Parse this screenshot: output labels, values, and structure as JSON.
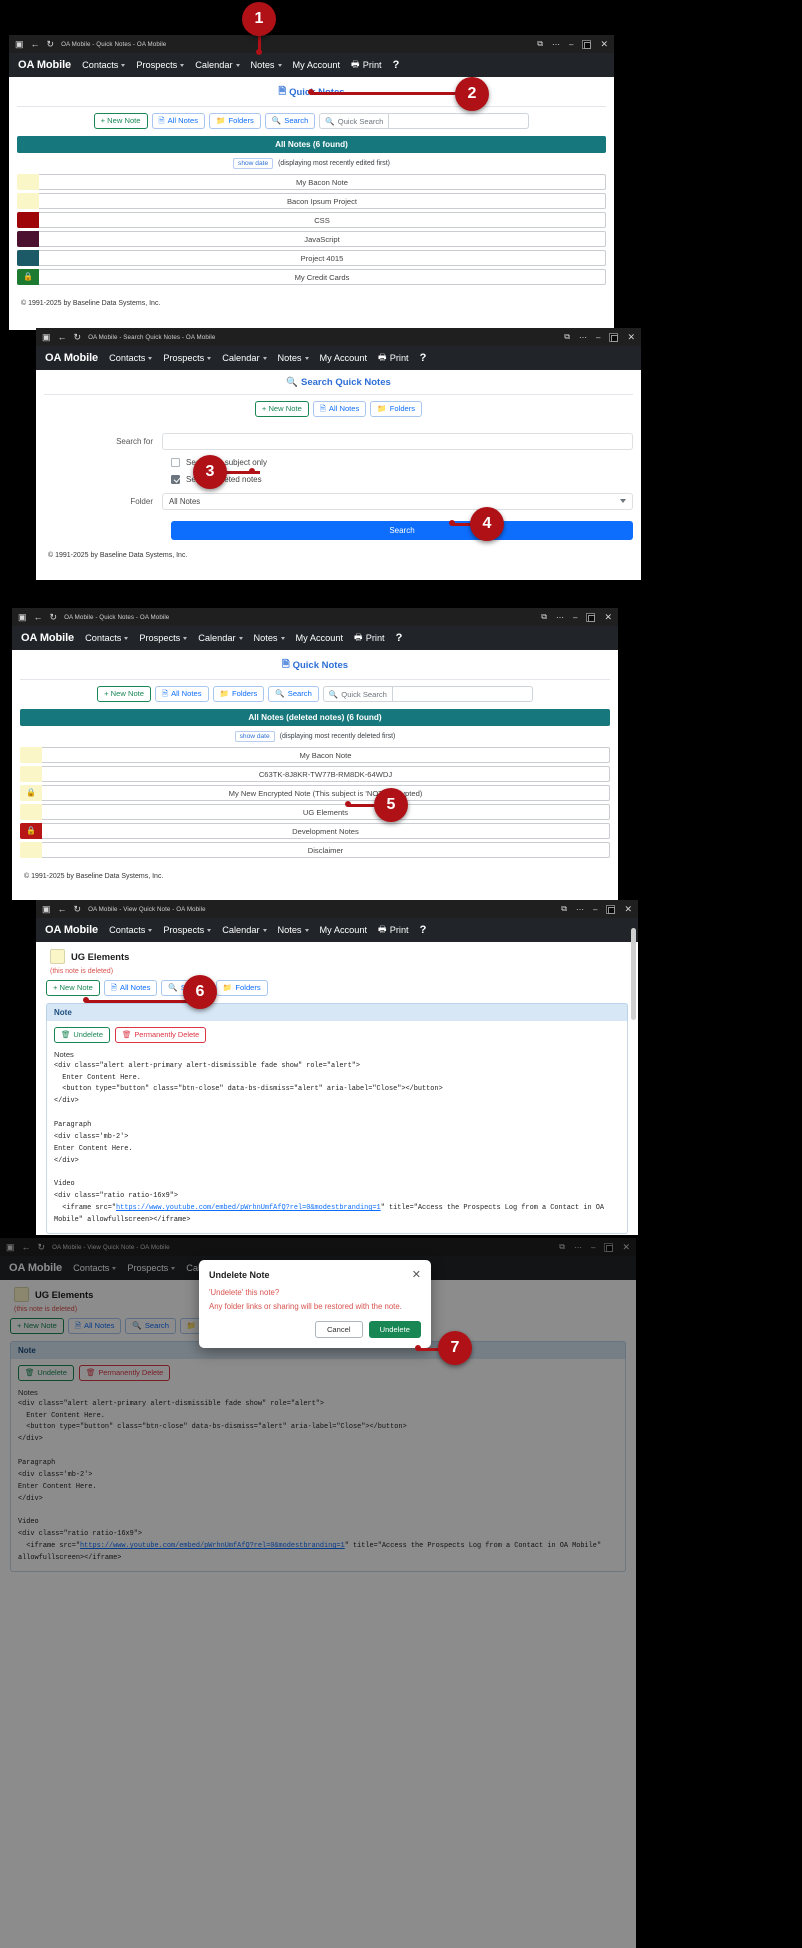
{
  "app": {
    "brand": "OA Mobile",
    "nav": [
      {
        "label": "Contacts",
        "caret": true
      },
      {
        "label": "Prospects",
        "caret": true
      },
      {
        "label": "Calendar",
        "caret": true
      },
      {
        "label": "Notes",
        "caret": true
      },
      {
        "label": "My Account",
        "caret": false
      },
      {
        "label": "Print",
        "caret": false,
        "icon": "printer-icon"
      },
      {
        "label": "?",
        "caret": false
      }
    ],
    "footer": "© 1991-2025 by Baseline Data Systems, Inc."
  },
  "panel1": {
    "window_title": "OA Mobile - Quick Notes - OA Mobile",
    "page_title": "Quick Notes",
    "toolbar": {
      "new_note": "+ New Note",
      "all_notes": "All Notes",
      "folders": "Folders",
      "search": "Search",
      "quick_search_label": "Quick Search",
      "quick_search_value": ""
    },
    "results_bar": "All Notes (6 found)",
    "show_date": "show date",
    "sort_note": "(displaying most recently edited first)",
    "notes": [
      {
        "subject": "My Bacon Note",
        "color": "#fbf6c8",
        "locked": false
      },
      {
        "subject": "Bacon Ipsum Project",
        "color": "#fbf6c8",
        "locked": false
      },
      {
        "subject": "CSS",
        "color": "#9e0509",
        "locked": false
      },
      {
        "subject": "JavaScript",
        "color": "#4b112f",
        "locked": false
      },
      {
        "subject": "Project 4015",
        "color": "#1b5a66",
        "locked": false
      },
      {
        "subject": "My Credit Cards",
        "color": "#1d7a31",
        "locked": true
      }
    ]
  },
  "panel2": {
    "window_title": "OA Mobile - Search Quick Notes - OA Mobile",
    "page_title": "Search Quick Notes",
    "toolbar": {
      "new_note": "+ New Note",
      "all_notes": "All Notes",
      "folders": "Folders"
    },
    "form": {
      "search_for_label": "Search for",
      "search_for_value": "",
      "subject_only_label": "Search on subject only",
      "subject_only_checked": false,
      "deleted_label": "Search deleted notes",
      "deleted_checked": true,
      "folder_label": "Folder",
      "folder_value": "All Notes",
      "folder_options": [
        "All Notes"
      ],
      "search_button": "Search"
    }
  },
  "panel3": {
    "window_title": "OA Mobile - Quick Notes - OA Mobile",
    "page_title": "Quick Notes",
    "toolbar": {
      "new_note": "+ New Note",
      "all_notes": "All Notes",
      "folders": "Folders",
      "search": "Search",
      "quick_search_label": "Quick Search",
      "quick_search_value": ""
    },
    "results_bar": "All Notes (deleted notes) (6 found)",
    "show_date": "show date",
    "sort_note": "(displaying most recently deleted first)",
    "notes": [
      {
        "subject": "My Bacon Note",
        "color": "#fbf6c8",
        "locked": false
      },
      {
        "subject": "C63TK-8J8KR-TW77B-RM8DK-64WDJ",
        "color": "#fbf6c8",
        "locked": false
      },
      {
        "subject": "My New Encrypted Note (This subject is 'NOT' encrypted)",
        "color": "#fbf6c8",
        "locked": true,
        "lock_color": "#8a7f2a"
      },
      {
        "subject": "UG Elements",
        "color": "#fbf6c8",
        "locked": false
      },
      {
        "subject": "Development Notes",
        "color": "#b81616",
        "locked": true,
        "lock_color": "#ffffff"
      },
      {
        "subject": "Disclaimer",
        "color": "#fbf6c8",
        "locked": false
      }
    ]
  },
  "panel4": {
    "window_title": "OA Mobile - View Quick Note - OA Mobile",
    "note_subject": "UG Elements",
    "deleted_flag": "(this note is deleted)",
    "toolbar": {
      "new_note": "+ New Note",
      "all_notes": "All Notes",
      "search": "Search",
      "folders": "Folders"
    },
    "card_title": "Note",
    "undelete_button": "Undelete",
    "permanently_delete_button": "Permanently Delete",
    "notes_label": "Notes",
    "code_line1": "<div class=\"alert alert-primary alert-dismissible fade show\" role=\"alert\">",
    "code_line2": "  Enter Content Here.",
    "code_line3": "  <button type=\"button\" class=\"btn-close\" data-bs-dismiss=\"alert\" aria-label=\"Close\"></button>",
    "code_line4": "</div>",
    "code_h_paragraph": "Paragraph",
    "code_line5": "<div class='mb-2'>",
    "code_line6": "Enter Content Here.",
    "code_line7": "</div>",
    "code_h_video": "Video",
    "code_line8": "<div class=\"ratio ratio-16x9\">",
    "code_line9a": "  <iframe src=\"",
    "code_link": "https://www.youtube.com/embed/pWrhnUmfAfQ?rel=0&modestbranding=1",
    "code_line9b": "\" title=\"Access the Prospects Log from a Contact in OA Mobile\" allowfullscreen></iframe>"
  },
  "panel5": {
    "window_title": "OA Mobile - View Quick Note - OA Mobile",
    "note_subject": "UG Elements",
    "deleted_flag": "(this note is deleted)",
    "toolbar": {
      "new_note": "+ New Note",
      "all_notes": "All Notes",
      "search": "Search",
      "folders": "Folders"
    },
    "card_title": "Note",
    "undelete_button": "Undelete",
    "permanently_delete_button": "Permanently Delete",
    "notes_label": "Notes",
    "modal": {
      "title": "Undelete Note",
      "close_icon": "close-icon",
      "line1": "'Undelete' this note?",
      "line2": "Any folder links or sharing will be restored with the note.",
      "cancel": "Cancel",
      "confirm": "Undelete"
    }
  },
  "callouts": [
    {
      "n": "1"
    },
    {
      "n": "2"
    },
    {
      "n": "3"
    },
    {
      "n": "4"
    },
    {
      "n": "5"
    },
    {
      "n": "6"
    },
    {
      "n": "7"
    }
  ],
  "colors": {
    "navbar": "#212529",
    "teal_bar": "#16787c",
    "primary_blue": "#0d6efd",
    "green": "#198754",
    "red": "#dc3545",
    "callout_red": "#b01116"
  }
}
